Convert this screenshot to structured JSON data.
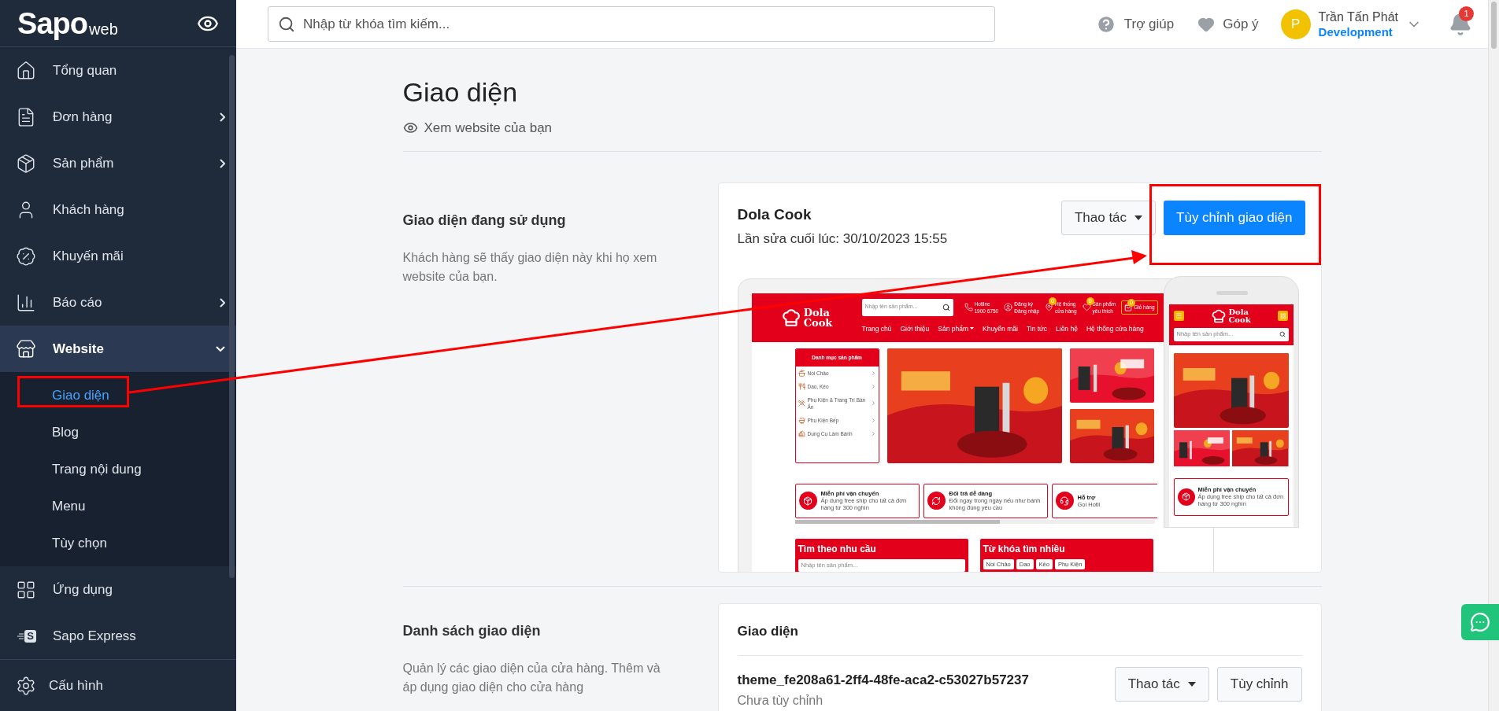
{
  "sidebar": {
    "logo": {
      "brand": "Sapo",
      "suffix": "web"
    },
    "items": [
      {
        "label": "Tổng quan",
        "expandable": false,
        "expanded": false
      },
      {
        "label": "Đơn hàng",
        "expandable": true,
        "expanded": false
      },
      {
        "label": "Sản phẩm",
        "expandable": true,
        "expanded": false
      },
      {
        "label": "Khách hàng",
        "expandable": false,
        "expanded": false
      },
      {
        "label": "Khuyến mãi",
        "expandable": false,
        "expanded": false
      },
      {
        "label": "Báo cáo",
        "expandable": true,
        "expanded": false
      },
      {
        "label": "Website",
        "expandable": true,
        "expanded": true,
        "children": [
          {
            "label": "Giao diện",
            "selected": true
          },
          {
            "label": "Blog",
            "selected": false
          },
          {
            "label": "Trang nội dung",
            "selected": false
          },
          {
            "label": "Menu",
            "selected": false
          },
          {
            "label": "Tùy chọn",
            "selected": false
          }
        ]
      },
      {
        "label": "Ứng dụng",
        "expandable": false,
        "expanded": false
      },
      {
        "label": "Sapo Express",
        "expandable": false,
        "expanded": false,
        "icon_letter": "S"
      }
    ],
    "footer": {
      "label": "Cấu hình"
    }
  },
  "topbar": {
    "search": {
      "placeholder": "Nhập từ khóa tìm kiếm..."
    },
    "help": "Trợ giúp",
    "feedback": "Góp ý",
    "user": {
      "initial": "P",
      "name": "Trần Tấn Phát",
      "role": "Development"
    },
    "notifications": "1"
  },
  "page": {
    "title": "Giao diện",
    "view_link": "Xem website của bạn"
  },
  "current_theme": {
    "heading": "Giao diện đang sử dụng",
    "description": "Khách hàng sẽ thấy giao diện này khi họ xem website của bạn.",
    "name": "Dola Cook",
    "updated": "Lần sửa cuối lúc: 30/10/2023 15:55",
    "actions_button": "Thao tác",
    "customize_button": "Tùy chỉnh giao diện",
    "preview": {
      "desktop": {
        "logo": [
          "Dola",
          "Cook"
        ],
        "search_placeholder": "Nhập tên sản phẩm...",
        "header_links": [
          {
            "line1": "Hotline",
            "line2": "1900 6750"
          },
          {
            "line1": "Đăng ký",
            "line2": "Đăng nhập"
          },
          {
            "line1": "Hệ thống",
            "line2": "cửa hàng",
            "count": "0"
          },
          {
            "line1": "Sản phẩm",
            "line2": "yêu thích",
            "count": "0"
          }
        ],
        "cart": {
          "label": "Giỏ hàng",
          "count": "0"
        },
        "nav": [
          {
            "label": "Trang chủ",
            "dropdown": false
          },
          {
            "label": "Giới thiệu",
            "dropdown": false
          },
          {
            "label": "Sản phẩm",
            "dropdown": true
          },
          {
            "label": "Khuyến mãi",
            "dropdown": false
          },
          {
            "label": "Tin tức",
            "dropdown": false
          },
          {
            "label": "Liên hệ",
            "dropdown": false
          },
          {
            "label": "Hệ thống cửa hàng",
            "dropdown": false
          }
        ],
        "category_title": "Danh mục sản phẩm",
        "categories": [
          "Nồi Chảo",
          "Dao, Kéo",
          "Phụ Kiện & Trang Trí Bàn Ăn",
          "Phụ Kiện Bếp",
          "Dụng Cụ Làm Bánh"
        ],
        "features": [
          {
            "title": "Miễn phí vận chuyển",
            "text": "Áp dụng free ship cho tất cả đơn hàng từ 300 nghìn"
          },
          {
            "title": "Đổi trả dễ dàng",
            "text": "Đổi ngay trong ngày nếu như bánh không đúng yêu cầu"
          },
          {
            "title": "Hỗ trợ",
            "text": "Gọi Hotli"
          }
        ],
        "needs": {
          "title": "Tìm theo nhu cầu",
          "placeholder": "Nhập tên sản phẩm..."
        },
        "keywords": {
          "title": "Từ khóa tìm nhiều",
          "tags": [
            "Nồi Chảo",
            "Dao",
            "Kéo",
            "Phụ Kiện"
          ]
        }
      },
      "mobile": {
        "logo": [
          "Dola",
          "Cook"
        ],
        "search_placeholder": "Nhập tên sản phẩm...",
        "feature": {
          "title": "Miễn phí vận chuyển",
          "text": "Áp dụng free ship cho tất cả đơn hàng từ 300 nghìn"
        }
      }
    }
  },
  "theme_list": {
    "heading": "Danh sách giao diện",
    "description": "Quản lý các giao diện của cửa hàng. Thêm và áp dụng giao diện cho cửa hàng",
    "card_title": "Giao diện",
    "themes": [
      {
        "name": "theme_fe208a61-2ff4-48fe-aca2-c53027b57237",
        "status": "Chưa tùy chỉnh",
        "actions_button": "Thao tác",
        "customize_button": "Tùy chỉnh"
      }
    ]
  }
}
